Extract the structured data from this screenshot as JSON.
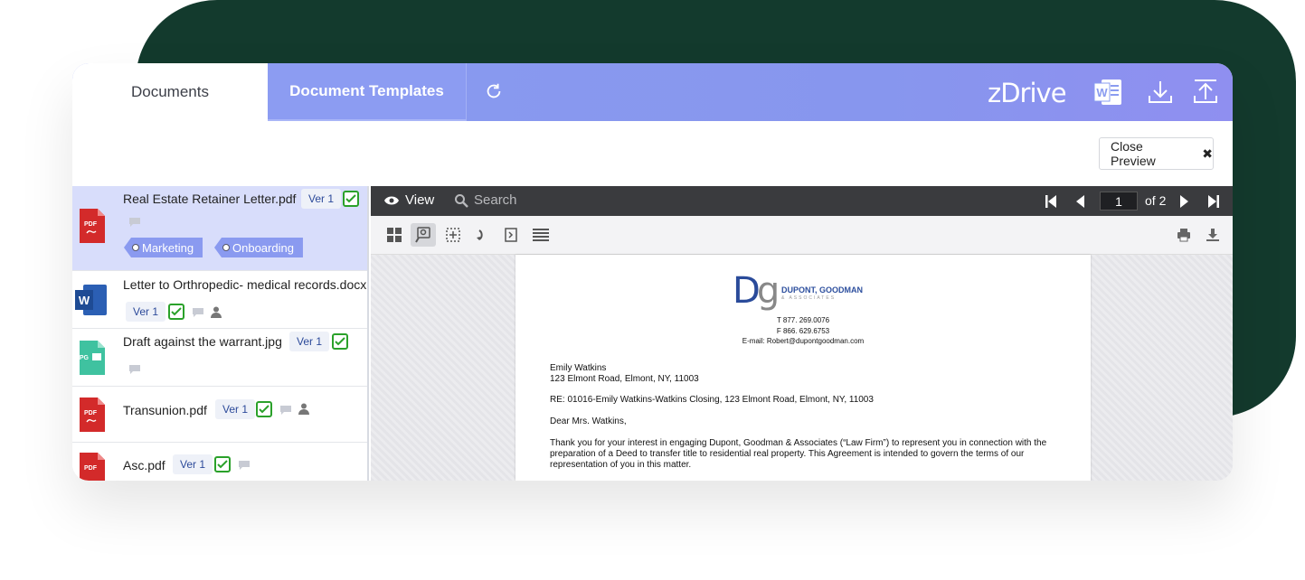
{
  "tabs": {
    "documents": "Documents",
    "templates": "Document Templates"
  },
  "brand": {
    "logo": "zDrive"
  },
  "toolbar_icons": [
    "refresh-icon",
    "word-icon",
    "download-icon",
    "upload-icon"
  ],
  "close_preview": {
    "label": "Close Preview",
    "icon": "✖"
  },
  "documents": [
    {
      "name": "Real Estate Retainer Letter.pdf",
      "type": "pdf",
      "version": "Ver 1",
      "checked": true,
      "comment": true,
      "user": false,
      "tags": [
        "Marketing",
        "Onboarding"
      ],
      "selected": true
    },
    {
      "name": "Letter to Orthropedic- medical records.docx",
      "type": "docx",
      "version": "Ver 1",
      "checked": true,
      "comment": true,
      "user": true,
      "tags": []
    },
    {
      "name": "Draft against the warrant.jpg",
      "type": "jpg",
      "version": "Ver 1",
      "checked": true,
      "comment": true,
      "user": false,
      "tags": []
    },
    {
      "name": "Transunion.pdf",
      "type": "pdf",
      "version": "Ver 1",
      "checked": true,
      "comment": true,
      "user": true,
      "tags": []
    },
    {
      "name": "Asc.pdf",
      "type": "pdf",
      "version": "Ver 1",
      "checked": true,
      "comment": true,
      "user": false,
      "tags": []
    }
  ],
  "file_icon_labels": {
    "pdf": "PDF",
    "docx": "W",
    "jpg": "JPG"
  },
  "viewer": {
    "view_label": "View",
    "search_label": "Search",
    "page_current": "1",
    "page_total": "of 2"
  },
  "letter": {
    "firm_name": "DUPONT, GOODMAN",
    "firm_sub": "& ASSOCIATES",
    "phone": "T 877. 269.0076",
    "fax": "F 866. 629.6753",
    "email": "E-mail:   Robert@dupontgoodman.com",
    "recipient_name": "Emily Watkins",
    "recipient_address": "123 Elmont Road, Elmont, NY, 11003",
    "re_line": "RE: 01016-Emily Watkins-Watkins Closing, 123 Elmont Road, Elmont, NY, 11003",
    "salutation": "Dear Mrs. Watkins,",
    "body": "Thank you for your interest in engaging Dupont, Goodman & Associates (“Law Firm”) to represent you in connection with the preparation of a Deed to transfer title to residential real property. This Agreement is intended to govern the terms of our representation of you in this matter."
  },
  "colors": {
    "header": "#8a9cf0",
    "dark_blob": "#133a2d",
    "selected_row": "#d8ddfb",
    "check": "#2aa12a",
    "tag": "#8a9af0"
  }
}
